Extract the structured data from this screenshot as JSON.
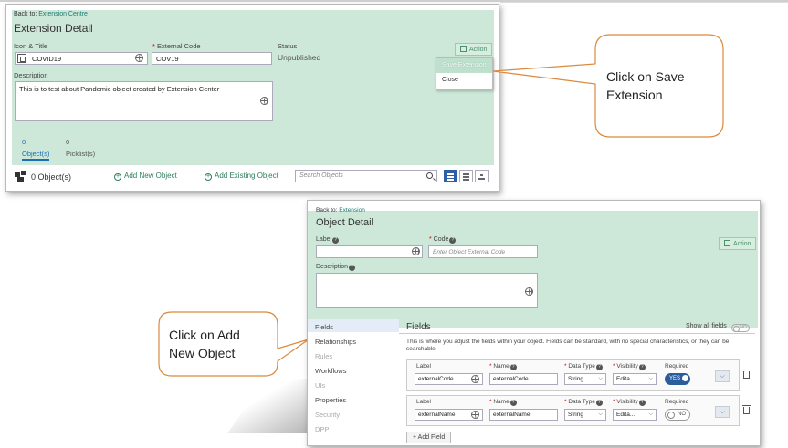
{
  "extension": {
    "back_prefix": "Back to:",
    "back_link": "Extension Centre",
    "title": "Extension Detail",
    "icon_title_label": "Icon & Title",
    "icon_title_value": "COVID19",
    "external_code_label": "External Code",
    "external_code_value": "COV19",
    "status_label": "Status",
    "status_value": "Unpublished",
    "action_label": "Action",
    "menu_items": [
      "Save Extension",
      "Close"
    ],
    "description_label": "Description",
    "description_value": "This is to test about Pandemic object created by Extension Center",
    "tabs": [
      {
        "count": "0",
        "label": "Object(s)"
      },
      {
        "count": "0",
        "label": "Picklist(s)"
      }
    ],
    "object_count": "0 Object(s)",
    "add_new_object": "Add New Object",
    "add_existing_object": "Add Existing Object",
    "search_placeholder": "Search Objects"
  },
  "callouts": {
    "save": [
      "Click on Save",
      "Extension"
    ],
    "add": [
      "Click on Add",
      "New Object"
    ]
  },
  "object_detail": {
    "back_prefix": "Back to:",
    "back_link": "Extension",
    "title": "Object Detail",
    "label_label": "Label",
    "code_label": "Code",
    "code_placeholder": "Enter Object External Code",
    "description_label": "Description",
    "action_label": "Action",
    "sidebar": [
      "Fields",
      "Relationships",
      "Rules",
      "Workflows",
      "UIs",
      "Properties",
      "Security",
      "DPP"
    ],
    "fields_title": "Fields",
    "show_all_fields": "Show all fields",
    "show_all_toggle": "NO",
    "intro": "This is where you adjust the fields within your object. Fields can be standard, with no special characteristics, or they can be searchable.",
    "col_label": "Label",
    "col_name": "Name",
    "col_data_type": "Data Type",
    "col_visibility": "Visibility",
    "col_required": "Required",
    "rows": [
      {
        "label": "externalCode",
        "name": "externalCode",
        "data_type": "String",
        "visibility": "Edita...",
        "required": "YES"
      },
      {
        "label": "externalName",
        "name": "externalName",
        "data_type": "String",
        "visibility": "Edita...",
        "required": "NO"
      }
    ],
    "add_field": "Add Field"
  }
}
